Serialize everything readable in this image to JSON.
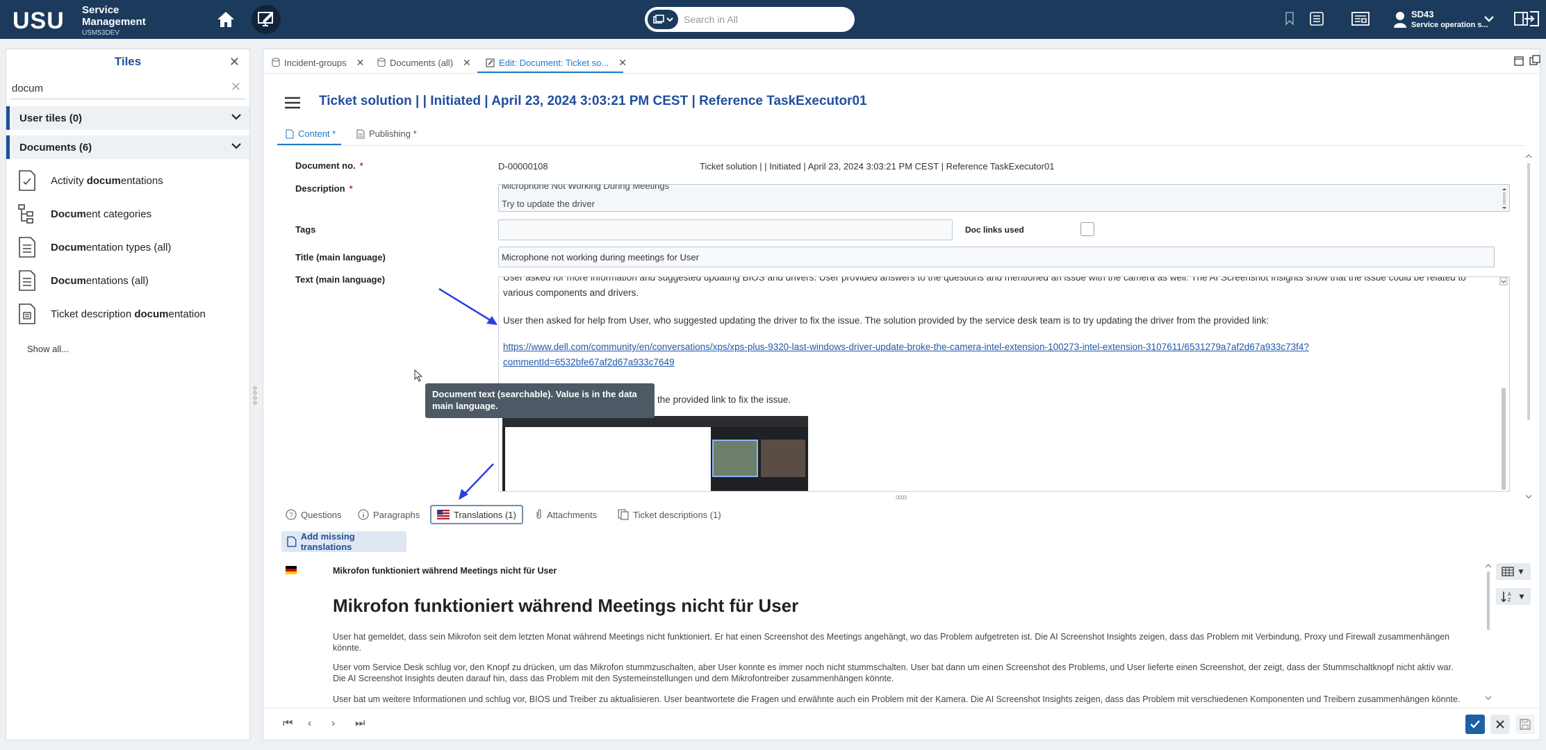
{
  "header": {
    "logo": "USU",
    "product_line1": "Service",
    "product_line2": "Management",
    "environment": "USM53DEV",
    "search_placeholder": "Search in All",
    "user_name": "SD43",
    "user_role": "Service operation s..."
  },
  "sidebar": {
    "title": "Tiles",
    "filter_value": "docum",
    "groups": [
      {
        "label": "User tiles (0)"
      },
      {
        "label": "Documents (6)"
      }
    ],
    "items": [
      {
        "pre": "Activity ",
        "match": "docum",
        "post": "entations"
      },
      {
        "pre": "",
        "match": "Docum",
        "post": "ent categories"
      },
      {
        "pre": "",
        "match": "Docum",
        "post": "entation types (all)"
      },
      {
        "pre": "",
        "match": "Docum",
        "post": "entations (all)"
      },
      {
        "pre": "Ticket description ",
        "match": "docum",
        "post": "entation"
      }
    ],
    "show_all": "Show all..."
  },
  "tabs": [
    {
      "label": "Incident-groups"
    },
    {
      "label": "Documents (all)"
    },
    {
      "label": "Edit: Document: Ticket so..."
    }
  ],
  "document": {
    "title": "Ticket solution | | Initiated | April 23, 2024 3:03:21 PM CEST | Reference TaskExecutor01",
    "subtabs": [
      "Content *",
      "Publishing *"
    ],
    "labels": {
      "doc_no": "Document no.",
      "description": "Description",
      "tags": "Tags",
      "doc_links": "Doc links used",
      "title_main": "Title (main language)",
      "text_main": "Text (main language)",
      "required_mark": "*"
    },
    "doc_no_value": "D-00000108",
    "doc_no_caption": "Ticket solution | | Initiated | April 23, 2024 3:03:21 PM CEST | Reference TaskExecutor01",
    "description_line1": "Microphone Not Working During Meetings",
    "description_line2": "Try to update the driver",
    "title_value": "Microphone not working during meetings for User",
    "text_para1": "User asked for more information and suggested updating BIOS and drivers. User provided answers to the questions and mentioned an issue with the camera as well. The AI Screenshot Insights show that the issue could be related to various components and drivers.",
    "text_para2": "User then asked for help from User, who suggested updating the driver to fix the issue. The solution provided by the service desk team is to try updating the driver from the provided link:",
    "text_link": "https://www.dell.com/community/en/conversations/xps/xps-plus-9320-last-windows-driver-update-broke-the-camera-intel-extension-100273-intel-extension-3107611/6531279a7af2d67a933c73f4?commentId=6532bfe67af2d67a933c7649",
    "text_para3": "the provided link to fix the issue.",
    "tooltip": "Document text (searchable). Value is in the data main language."
  },
  "bottom_tabs": [
    {
      "label": "Questions"
    },
    {
      "label": "Paragraphs"
    },
    {
      "label": "Translations (1)"
    },
    {
      "label": "Attachments"
    },
    {
      "label": "Ticket descriptions (1)"
    }
  ],
  "translations": {
    "add_button": "Add missing translations",
    "title": "Mikrofon funktioniert während Meetings nicht für User",
    "heading": "Mikrofon funktioniert während Meetings nicht für User",
    "para1": "User hat gemeldet, dass sein Mikrofon seit dem letzten Monat während Meetings nicht funktioniert. Er hat einen Screenshot des Meetings angehängt, wo das Problem aufgetreten ist. Die AI Screenshot Insights zeigen, dass das Problem mit Verbindung, Proxy und Firewall zusammenhängen könnte.",
    "para2": "User vom Service Desk schlug vor, den Knopf zu drücken, um das Mikrofon stummzuschalten, aber User konnte es immer noch nicht stummschalten. User bat dann um einen Screenshot des Problems, und User lieferte einen Screenshot, der zeigt, dass der Stummschaltknopf nicht aktiv war. Die AI Screenshot Insights deuten darauf hin, dass das Problem mit den Systemeinstellungen und dem Mikrofontreiber zusammenhängen könnte.",
    "para3": "User bat um weitere Informationen und schlug vor, BIOS und Treiber zu aktualisieren. User beantwortete die Fragen und erwähnte auch ein Problem mit der Kamera. Die AI Screenshot Insights zeigen, dass das Problem mit verschiedenen Komponenten und Treibern zusammenhängen könnte."
  },
  "colors": {
    "header_bg": "#1b3a5c",
    "accent": "#1f4e9c",
    "link": "#1f78c9",
    "confirm": "#1f5fa8"
  }
}
